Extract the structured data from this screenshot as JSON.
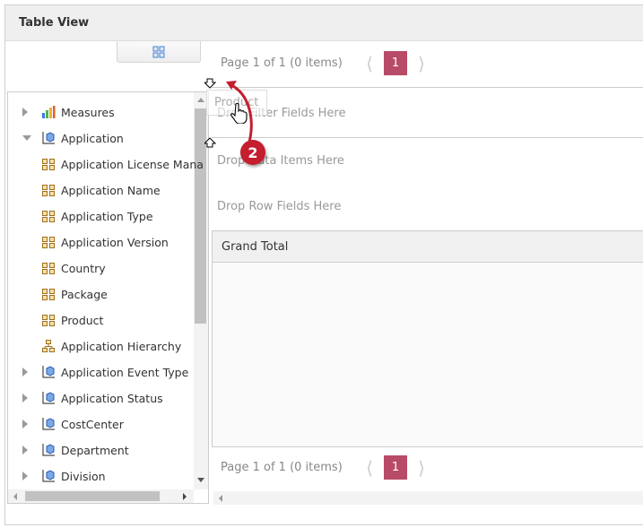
{
  "header": {
    "title": "Table View"
  },
  "pager_top": {
    "text": "Page 1 of 1 (0 items)",
    "page": "1"
  },
  "pager_bottom": {
    "text": "Page 1 of 1 (0 items)",
    "page": "1"
  },
  "tree": [
    {
      "label": "Measures",
      "icon": "measures-icon",
      "expander": "collapsed"
    },
    {
      "label": "Application",
      "icon": "dimension-icon",
      "expander": "expanded"
    },
    {
      "label": "Application License Mana",
      "icon": "attribute-icon",
      "expander": "none"
    },
    {
      "label": "Application Name",
      "icon": "attribute-icon",
      "expander": "none"
    },
    {
      "label": "Application Type",
      "icon": "attribute-icon",
      "expander": "none"
    },
    {
      "label": "Application Version",
      "icon": "attribute-icon",
      "expander": "none"
    },
    {
      "label": "Country",
      "icon": "attribute-icon",
      "expander": "none"
    },
    {
      "label": "Package",
      "icon": "attribute-icon",
      "expander": "none"
    },
    {
      "label": "Product",
      "icon": "attribute-icon",
      "expander": "none"
    },
    {
      "label": "Application Hierarchy",
      "icon": "hierarchy-icon",
      "expander": "none"
    },
    {
      "label": "Application Event Type",
      "icon": "dimension-icon",
      "expander": "collapsed"
    },
    {
      "label": "Application Status",
      "icon": "dimension-icon",
      "expander": "collapsed"
    },
    {
      "label": "CostCenter",
      "icon": "dimension-icon",
      "expander": "collapsed"
    },
    {
      "label": "Department",
      "icon": "dimension-icon",
      "expander": "collapsed"
    },
    {
      "label": "Division",
      "icon": "dimension-icon",
      "expander": "collapsed"
    }
  ],
  "zones": {
    "filter": "Drop Filter Fields Here",
    "data": "Drop Data Items Here",
    "row": "Drop Row Fields Here"
  },
  "grid": {
    "grand_total": "Grand Total"
  },
  "drag": {
    "ghost_label": "Product",
    "step_badge": "2"
  },
  "colors": {
    "accent": "#b84b68",
    "badge": "#c41e2f"
  }
}
